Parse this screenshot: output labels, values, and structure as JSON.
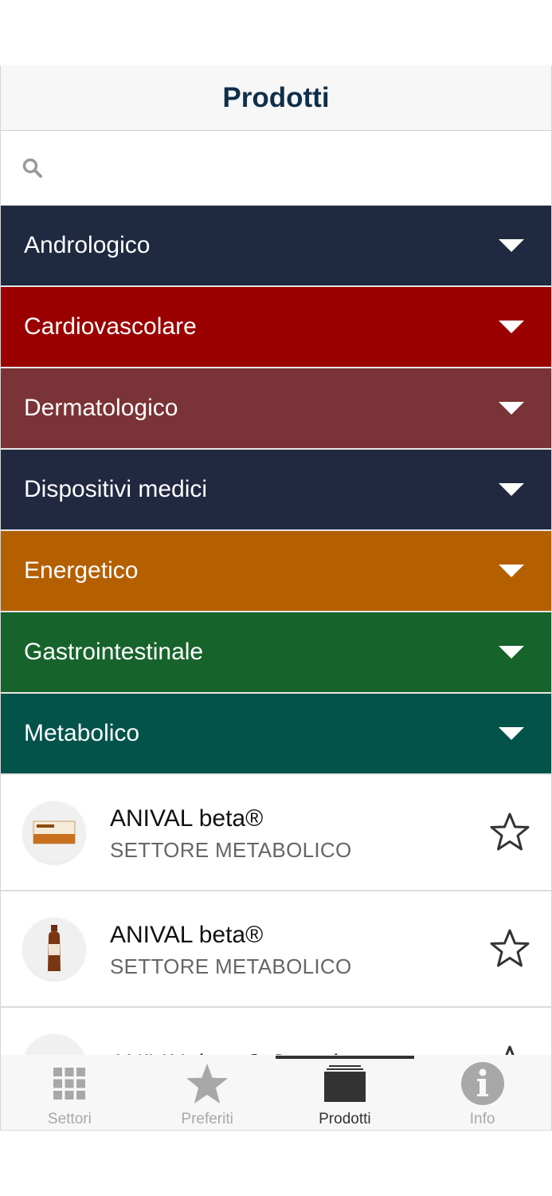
{
  "header": {
    "title": "Prodotti"
  },
  "search": {
    "placeholder": "",
    "value": ""
  },
  "categories": [
    {
      "label": "Andrologico",
      "color": "#1f2a40"
    },
    {
      "label": "Cardiovascolare",
      "color": "#9b0000"
    },
    {
      "label": "Dermatologico",
      "color": "#7a3336"
    },
    {
      "label": "Dispositivi medici",
      "color": "#222840"
    },
    {
      "label": "Energetico",
      "color": "#b45f00"
    },
    {
      "label": "Gastrointestinale",
      "color": "#17632c"
    },
    {
      "label": "Metabolico",
      "color": "#03534a"
    }
  ],
  "products": [
    {
      "name": "ANIVAL beta®",
      "sector": "SETTORE METABOLICO",
      "image": "anival-box"
    },
    {
      "name": "ANIVAL beta®",
      "sector": "SETTORE METABOLICO",
      "image": "anival-bottle"
    },
    {
      "name": "ANIVAL beta® Complex",
      "sector": "",
      "image": "anival-complex"
    }
  ],
  "tabs": [
    {
      "label": "Settori",
      "icon": "grid-icon",
      "active": false
    },
    {
      "label": "Preferiti",
      "icon": "star-icon",
      "active": false
    },
    {
      "label": "Prodotti",
      "icon": "folder-icon",
      "active": true
    },
    {
      "label": "Info",
      "icon": "info-icon",
      "active": false
    }
  ]
}
